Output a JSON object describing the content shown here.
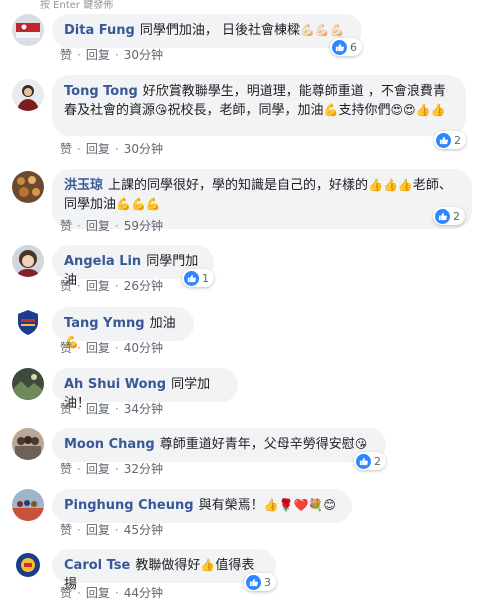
{
  "top_hint": "按 Enter 鍵發佈",
  "colors": {
    "author": "#385898",
    "bubble": "#f2f3f5",
    "like_blue": "#2d88ff",
    "meta": "#606770"
  },
  "comments": [
    {
      "author": "Dita Fung",
      "text": "同學們加油， 日後社會棟樑",
      "emoji": "💪🏻💪🏻💪🏻",
      "like_label": "赞",
      "reply_label": "回复",
      "time": "30分钟",
      "reactions": "6",
      "avatar_icon": "flag-avatar-icon"
    },
    {
      "author": "Tong Tong",
      "text": "好欣賞教聯學生，明道理，能尊師重道 ，不會浪費青春及社會的資源",
      "text2": "祝校長，老師，同學，加油",
      "text3": "支持你們",
      "emoji1": "😘",
      "emoji2": "💪",
      "emoji3": "😍😍👍👍",
      "like_label": "赞",
      "reply_label": "回复",
      "time": "30分钟",
      "reactions": "2",
      "avatar_icon": "portrait-avatar-icon"
    },
    {
      "author": "洪玉琼",
      "text": "上課的同學很好，學的知識是自己的，好樣的",
      "text2": "老師、同學加油",
      "emoji1": "👍👍👍",
      "emoji2": "💪💪💪",
      "like_label": "赞",
      "reply_label": "回复",
      "time": "59分钟",
      "reactions": "2",
      "avatar_icon": "food-avatar-icon"
    },
    {
      "author": "Angela Lin",
      "text": "同學門加油",
      "like_label": "赞",
      "reply_label": "回复",
      "time": "26分钟",
      "reactions": "1",
      "avatar_icon": "face-avatar-icon"
    },
    {
      "author": "Tang Ymng",
      "text": "加油",
      "emoji": "💪",
      "like_label": "赞",
      "reply_label": "回复",
      "time": "40分钟",
      "avatar_icon": "crest-avatar-icon"
    },
    {
      "author": "Ah Shui Wong",
      "text": "同学加油！",
      "like_label": "赞",
      "reply_label": "回复",
      "time": "34分钟",
      "avatar_icon": "landscape-avatar-icon"
    },
    {
      "author": "Moon Chang",
      "text": "尊師重道好青年，父母辛勞得安慰",
      "emoji": "😘",
      "like_label": "赞",
      "reply_label": "回复",
      "time": "32分钟",
      "reactions": "2",
      "avatar_icon": "group-avatar-icon"
    },
    {
      "author": "Pinghung Cheung",
      "text": "與有榮焉！",
      "emoji": "👍🌹❤️💐😊",
      "like_label": "赞",
      "reply_label": "回复",
      "time": "45分钟",
      "avatar_icon": "crowd-avatar-icon"
    },
    {
      "author": "Carol Tse",
      "text": "教聯做得好",
      "emoji": "👍",
      "text2": "值得表揚",
      "like_label": "赞",
      "reply_label": "回复",
      "time": "44分钟",
      "reactions": "3",
      "avatar_icon": "badge-avatar-icon"
    }
  ]
}
